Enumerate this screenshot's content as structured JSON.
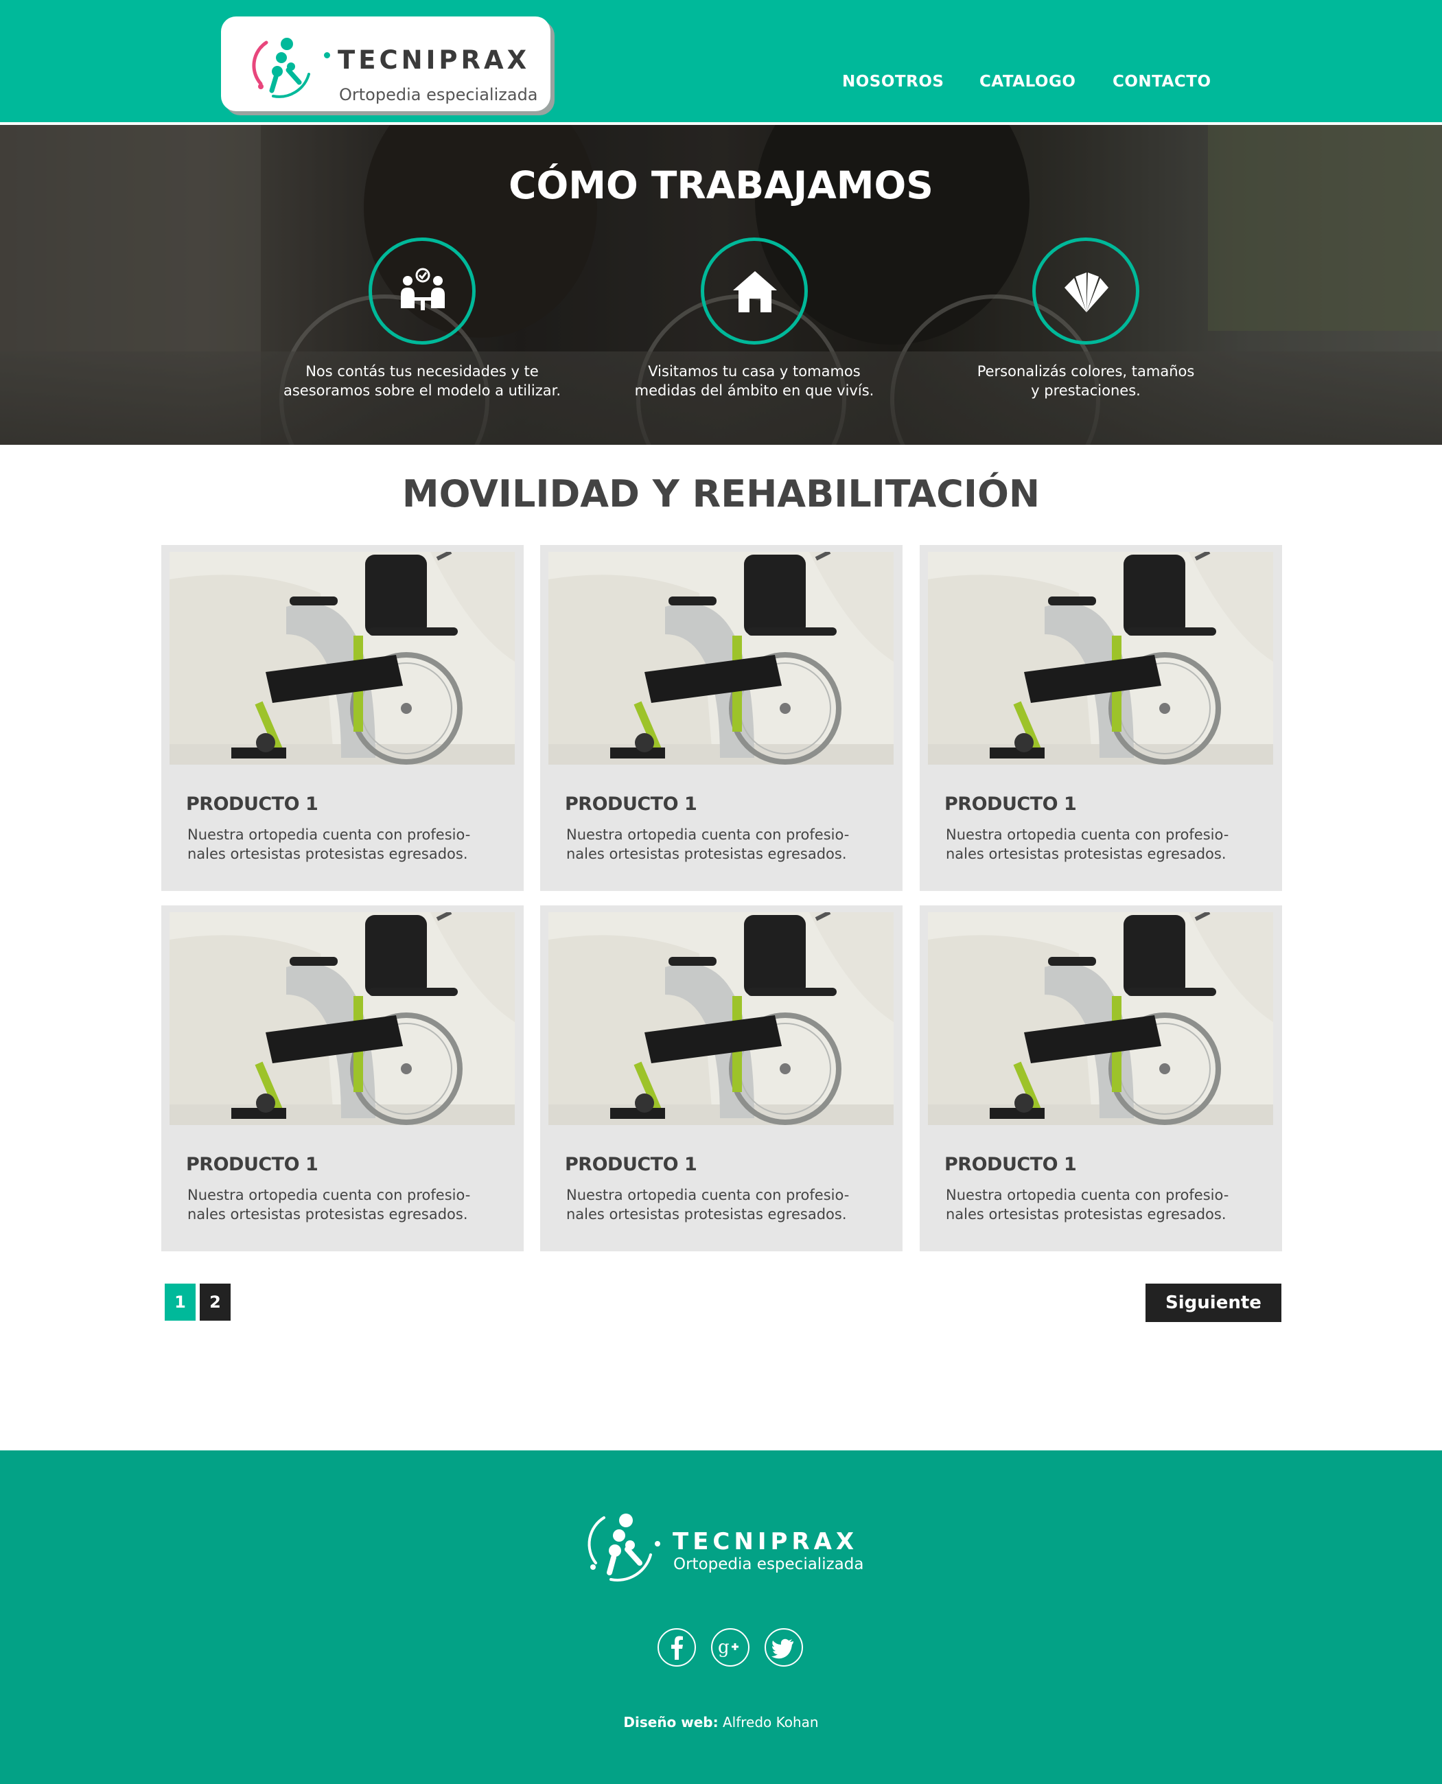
{
  "brand": {
    "name": "TECNIPRAX",
    "tagline": "Ortopedia especializada",
    "accent_color": "#00b99a",
    "footer_color": "#03a286"
  },
  "nav": {
    "items": [
      "NOSOTROS",
      "CATALOGO",
      "CONTACTO"
    ]
  },
  "hero": {
    "title": "CÓMO TRABAJAMOS",
    "steps": [
      {
        "icon": "consultation-icon",
        "text_line1": "Nos contás tus necesidades y te",
        "text_line2": "asesoramos sobre el modelo a utilizar."
      },
      {
        "icon": "house-icon",
        "text_line1": "Visitamos tu casa y tomamos",
        "text_line2": "medidas del ámbito en que vivís."
      },
      {
        "icon": "color-swatch-icon",
        "text_line1": "Personalizás colores, tamaños",
        "text_line2": "y prestaciones."
      }
    ]
  },
  "catalog": {
    "title": "MOVILIDAD Y REHABILITACIÓN",
    "products": [
      {
        "name": "PRODUCTO 1",
        "desc_line1": "Nuestra  ortopedia cuenta con profesio-",
        "desc_line2": "nales ortesistas protesistas egresados.",
        "image": "wheelchair-photo"
      },
      {
        "name": "PRODUCTO 1",
        "desc_line1": "Nuestra  ortopedia cuenta con profesio-",
        "desc_line2": "nales ortesistas protesistas egresados.",
        "image": "wheelchair-photo"
      },
      {
        "name": "PRODUCTO 1",
        "desc_line1": "Nuestra  ortopedia cuenta con profesio-",
        "desc_line2": "nales ortesistas protesistas egresados.",
        "image": "wheelchair-photo"
      },
      {
        "name": "PRODUCTO 1",
        "desc_line1": "Nuestra  ortopedia cuenta con profesio-",
        "desc_line2": "nales ortesistas protesistas egresados.",
        "image": "wheelchair-photo"
      },
      {
        "name": "PRODUCTO 1",
        "desc_line1": "Nuestra  ortopedia cuenta con profesio-",
        "desc_line2": "nales ortesistas protesistas egresados.",
        "image": "wheelchair-photo"
      },
      {
        "name": "PRODUCTO 1",
        "desc_line1": "Nuestra  ortopedia cuenta con profesio-",
        "desc_line2": "nales ortesistas protesistas egresados.",
        "image": "wheelchair-photo"
      }
    ]
  },
  "pagination": {
    "pages": [
      "1",
      "2"
    ],
    "current_page": "1",
    "next_label": "Siguiente",
    "active_color": "#00b99a",
    "inactive_color": "#222222"
  },
  "footer": {
    "social": [
      "facebook-icon",
      "google-plus-icon",
      "twitter-icon"
    ],
    "credit_label": "Diseño web:",
    "credit_name": "Alfredo Kohan"
  }
}
